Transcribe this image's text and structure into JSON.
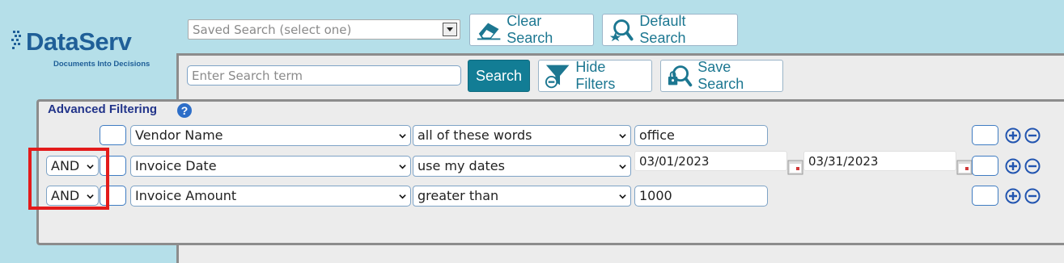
{
  "logo": {
    "wordmark": "DataServ",
    "tagline": "Documents Into Decisions"
  },
  "saved_search": {
    "placeholder": "Saved Search (select one)"
  },
  "toolbar": {
    "clear_label": "Clear Search",
    "default_label": "Default Search",
    "search_label": "Search",
    "hide_filters_label": "Hide Filters",
    "save_search_label": "Save Search"
  },
  "search_term": {
    "placeholder": "Enter Search term"
  },
  "advanced": {
    "title": "Advanced Filtering",
    "rows": [
      {
        "connector": "",
        "field": "Vendor Name",
        "operator": "all of these words",
        "value": "office"
      },
      {
        "connector": "AND",
        "field": "Invoice Date",
        "operator": "use my dates",
        "date_from": "03/01/2023",
        "date_to": "03/31/2023"
      },
      {
        "connector": "AND",
        "field": "Invoice Amount",
        "operator": "greater than",
        "value": "1000"
      }
    ]
  },
  "colors": {
    "background": "#b5dfe9",
    "accent": "#127d95",
    "highlight": "#e31b1b"
  }
}
